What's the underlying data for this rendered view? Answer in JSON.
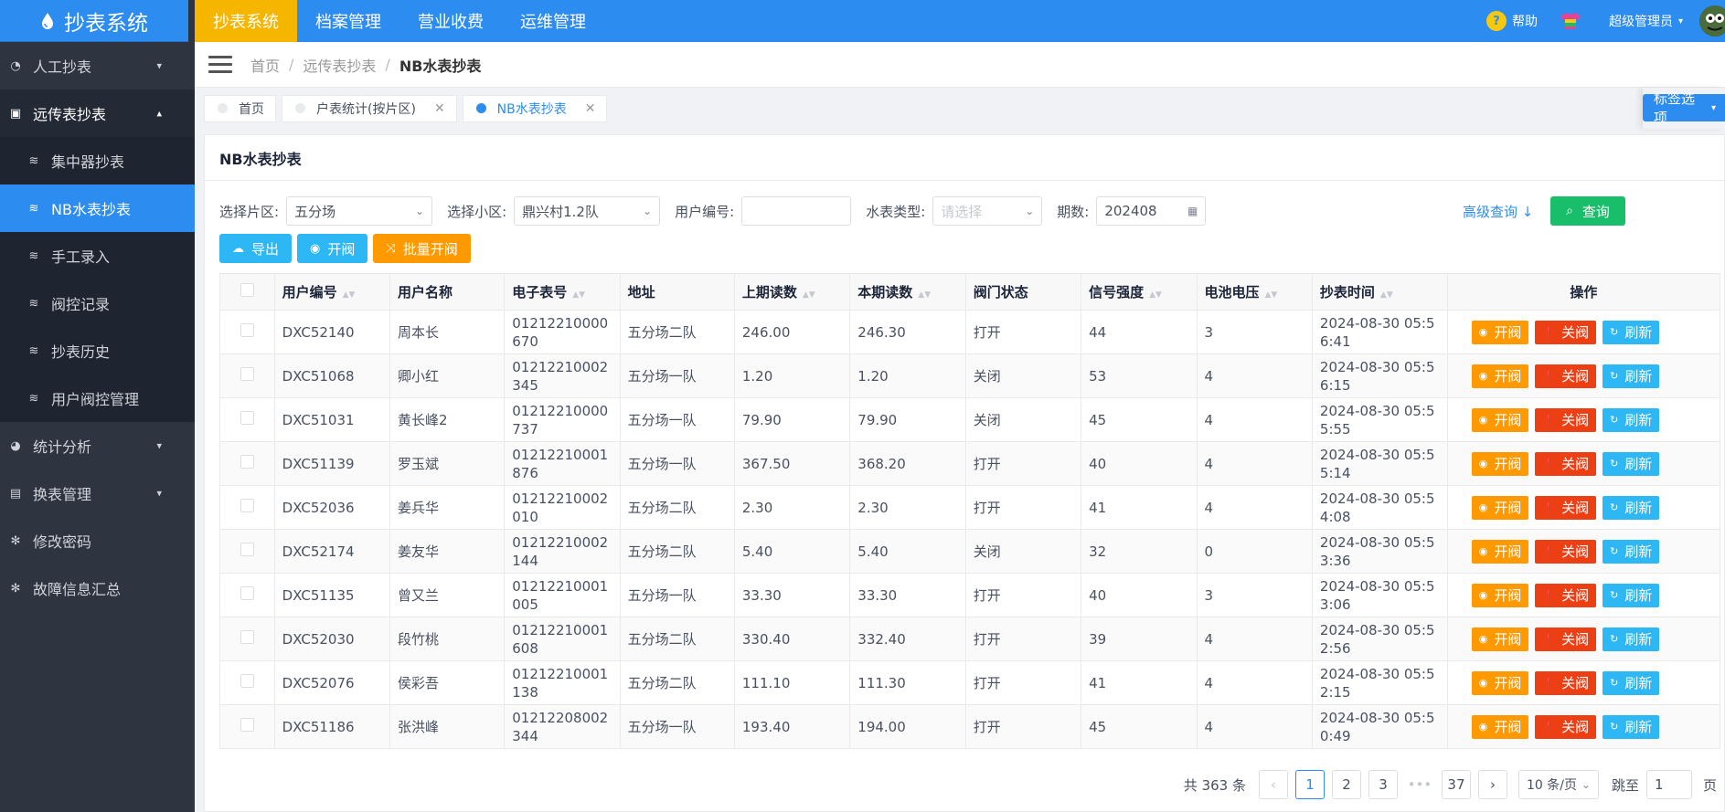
{
  "app": {
    "title": "抄表系统"
  },
  "topnav": [
    "抄表系统",
    "档案管理",
    "营业收费",
    "运维管理"
  ],
  "topright": {
    "help": "帮助",
    "user": "超级管理员"
  },
  "sidebar": {
    "items": [
      {
        "label": "人工抄表",
        "arrow": "⌄"
      },
      {
        "label": "远传表抄表",
        "arrow": "⌃"
      }
    ],
    "sub": [
      "集中器抄表",
      "NB水表抄表",
      "手工录入",
      "阀控记录",
      "抄表历史",
      "用户阀控管理"
    ],
    "rest": [
      {
        "label": "统计分析",
        "arrow": "⌄"
      },
      {
        "label": "换表管理",
        "arrow": "⌄"
      },
      {
        "label": "修改密码"
      },
      {
        "label": "故障信息汇总"
      }
    ]
  },
  "breadcrumb": [
    "首页",
    "远传表抄表",
    "NB水表抄表"
  ],
  "tags": [
    "首页",
    "户表统计(按片区)",
    "NB水表抄表"
  ],
  "tag_options": "标签选项",
  "card_title": "NB水表抄表",
  "filters": {
    "area_label": "选择片区:",
    "area_value": "五分场",
    "community_label": "选择小区:",
    "community_value": "鼎兴村1.2队",
    "user_no_label": "用户编号:",
    "user_no_value": "",
    "meter_type_label": "水表类型:",
    "meter_type_placeholder": "请选择",
    "period_label": "期数:",
    "period_value": "202408",
    "advanced": "高级查询",
    "query": "查询"
  },
  "actions": {
    "export": "导出",
    "open": "开阀",
    "batch_open": "批量开阀"
  },
  "columns": [
    "用户编号",
    "用户名称",
    "电子表号",
    "地址",
    "上期读数",
    "本期读数",
    "阀门状态",
    "信号强度",
    "电池电压",
    "抄表时间",
    "操作"
  ],
  "rows": [
    [
      "DXC52140",
      "周本长",
      "01212210000670",
      "五分场二队",
      "246.00",
      "246.30",
      "打开",
      "44",
      "3",
      "2024-08-30 05:56:41"
    ],
    [
      "DXC51068",
      "卿小红",
      "01212210002345",
      "五分场一队",
      "1.20",
      "1.20",
      "关闭",
      "53",
      "4",
      "2024-08-30 05:56:15"
    ],
    [
      "DXC51031",
      "黄长峰2",
      "01212210000737",
      "五分场一队",
      "79.90",
      "79.90",
      "关闭",
      "45",
      "4",
      "2024-08-30 05:55:55"
    ],
    [
      "DXC51139",
      "罗玉斌",
      "01212210001876",
      "五分场一队",
      "367.50",
      "368.20",
      "打开",
      "40",
      "4",
      "2024-08-30 05:55:14"
    ],
    [
      "DXC52036",
      "姜兵华",
      "01212210002010",
      "五分场二队",
      "2.30",
      "2.30",
      "打开",
      "41",
      "4",
      "2024-08-30 05:54:08"
    ],
    [
      "DXC52174",
      "姜友华",
      "01212210002144",
      "五分场二队",
      "5.40",
      "5.40",
      "关闭",
      "32",
      "0",
      "2024-08-30 05:53:36"
    ],
    [
      "DXC51135",
      "曾又兰",
      "01212210001005",
      "五分场一队",
      "33.30",
      "33.30",
      "打开",
      "40",
      "3",
      "2024-08-30 05:53:06"
    ],
    [
      "DXC52030",
      "段竹桃",
      "01212210001608",
      "五分场二队",
      "330.40",
      "332.40",
      "打开",
      "39",
      "4",
      "2024-08-30 05:52:56"
    ],
    [
      "DXC52076",
      "侯彩吾",
      "01212210001138",
      "五分场二队",
      "111.10",
      "111.30",
      "打开",
      "41",
      "4",
      "2024-08-30 05:52:15"
    ],
    [
      "DXC51186",
      "张洪峰",
      "01212208002344",
      "五分场一队",
      "193.40",
      "194.00",
      "打开",
      "45",
      "4",
      "2024-08-30 05:50:49"
    ]
  ],
  "row_ops": {
    "open": "开阀",
    "close": "关阀",
    "refresh": "刷新"
  },
  "pager": {
    "total": "共 363 条",
    "pages": [
      "1",
      "2",
      "3",
      "•••",
      "37"
    ],
    "size": "10 条/页",
    "jump": "跳至",
    "jump_value": "1",
    "page_unit": "页"
  },
  "colors": {
    "primary": "#2d8cf0",
    "active_nav": "#f6b600",
    "query": "#19be6b",
    "export": "#2db7f5",
    "batch": "#ff9900",
    "close": "#ed3f14"
  }
}
